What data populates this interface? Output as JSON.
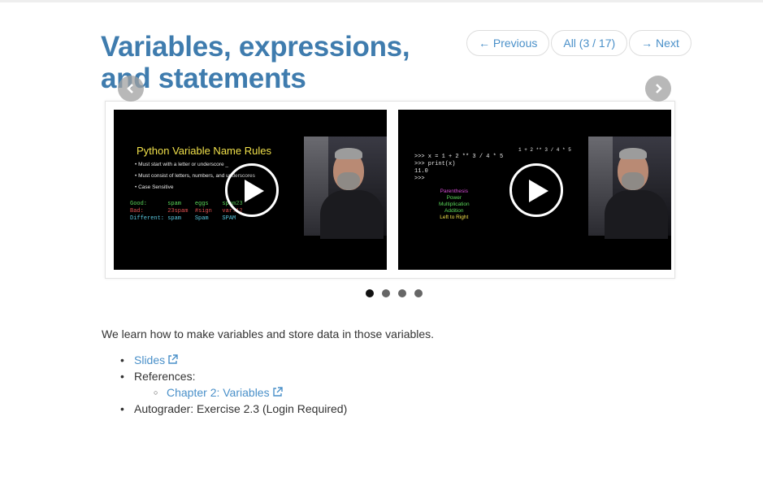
{
  "page": {
    "title": "Variables, expressions, and statements"
  },
  "pager": {
    "previous_label": "← Previous",
    "all_label": "All (3 / 17)",
    "next_label": "→ Next"
  },
  "carousel": {
    "slides": [
      {
        "title": "Python Variable Name Rules",
        "bullets": [
          "Must start with a letter or underscore _",
          "Must consist of letters, numbers, and underscores",
          "Case Sensitive"
        ],
        "code_lines": [
          "Good:      spam    eggs    spam23",
          "Bad:       23spam  #sign   var.12",
          "Different: spam    Spam    SPAM"
        ]
      },
      {
        "code_lines": [
          ">>> x = 1 + 2 ** 3 / 4 * 5",
          ">>> print(x)",
          "11.0",
          ">>>"
        ],
        "expression": "1 + 2 ** 3 / 4 * 5",
        "operators": [
          "Parenthesis",
          "Power",
          "Multiplication",
          "Addition",
          "Left to Right"
        ]
      }
    ],
    "dot_count": 4,
    "active_dot": 0
  },
  "content": {
    "description": "We learn how to make variables and store data in those variables.",
    "slides_link": "Slides",
    "references_label": "References:",
    "chapter_link": "Chapter 2: Variables",
    "autograder_text": "Autograder: Exercise 2.3 (Login Required)"
  },
  "colors": {
    "title": "#3f7cae",
    "link": "#4a90c9"
  }
}
